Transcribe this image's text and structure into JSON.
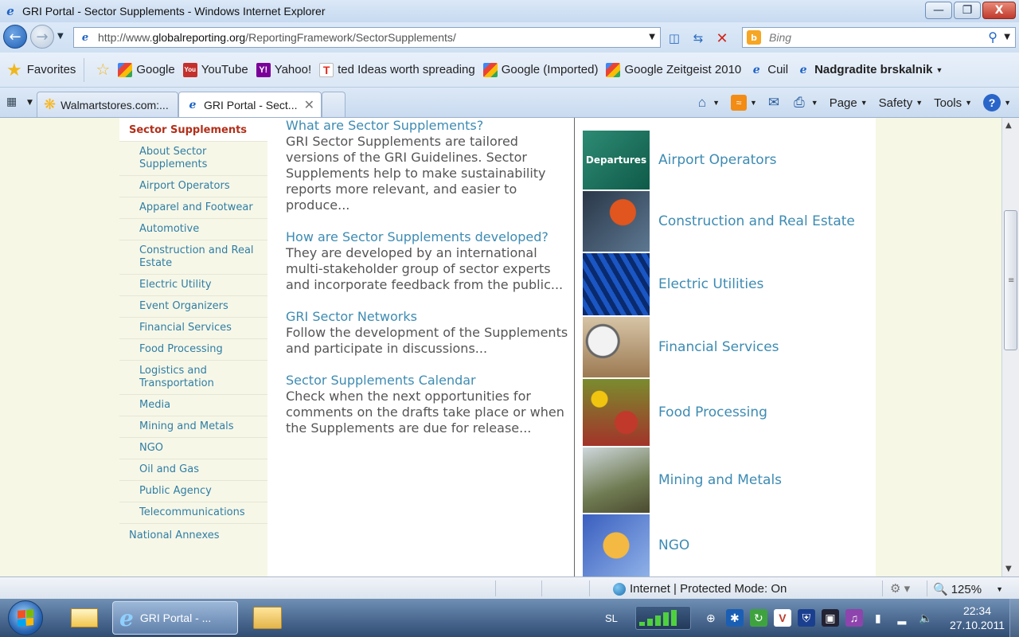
{
  "window": {
    "title": "GRI Portal - Sector Supplements - Windows Internet Explorer",
    "minimize": "—",
    "restore": "❐",
    "close": "X"
  },
  "address": {
    "url_prefix": "http://www.",
    "url_domain": "globalreporting.org",
    "url_path": "/ReportingFramework/SectorSupplements/",
    "search_placeholder": "Bing"
  },
  "favorites": {
    "label": "Favorites",
    "items": [
      {
        "label": "Google",
        "icon": "google-icon"
      },
      {
        "label": "YouTube",
        "icon": "youtube-icon"
      },
      {
        "label": "Yahoo!",
        "icon": "yahoo-icon"
      },
      {
        "label": "ted Ideas worth spreading",
        "icon": "ted-icon"
      },
      {
        "label": "Google (Imported)",
        "icon": "google-icon"
      },
      {
        "label": "Google Zeitgeist 2010",
        "icon": "google-icon"
      },
      {
        "label": "Cuil",
        "icon": "ie-page-icon"
      },
      {
        "label": "Nadgradite brskalnik",
        "icon": "ie-page-icon"
      }
    ]
  },
  "tabs": [
    {
      "label": "Walmartstores.com:..."
    },
    {
      "label": "GRI Portal - Sect...",
      "active": true
    }
  ],
  "commands": {
    "page": "Page",
    "safety": "Safety",
    "tools": "Tools"
  },
  "sidebar": {
    "heading": "Sector Supplements",
    "items": [
      "About Sector Supplements",
      "Airport Operators",
      "Apparel and Footwear",
      "Automotive",
      "Construction and Real Estate",
      "Electric Utility",
      "Event Organizers",
      "Financial Services",
      "Food Processing",
      "Logistics and Transportation",
      "Media",
      "Mining and Metals",
      "NGO",
      "Oil and Gas",
      "Public Agency",
      "Telecommunications"
    ],
    "footer": "National Annexes"
  },
  "content": {
    "sections": [
      {
        "title": "What are Sector Supplements?",
        "body": "GRI Sector Supplements are tailored versions of the GRI Guidelines. Sector Supplements help to make sustainability reports more relevant, and easier to produce..."
      },
      {
        "title": "How are Sector Supplements developed?",
        "body": "They are developed by an international multi-stakeholder group of sector experts and incorporate feedback from the public..."
      },
      {
        "title": "GRI Sector Networks",
        "body": "Follow the development of the Supplements and participate in discussions..."
      },
      {
        "title": "Sector Supplements Calendar",
        "body": "Check when the next opportunities for comments on the drafts take place or when the Supplements are due for release..."
      }
    ]
  },
  "sectors": [
    {
      "label": "Airport Operators",
      "image_text": "Departures"
    },
    {
      "label": "Construction and Real Estate"
    },
    {
      "label": "Electric Utilities"
    },
    {
      "label": "Financial Services"
    },
    {
      "label": "Food Processing"
    },
    {
      "label": "Mining and Metals"
    },
    {
      "label": "NGO"
    }
  ],
  "status": {
    "zone": "Internet | Protected Mode: On",
    "zoom": "125%"
  },
  "taskbar": {
    "ie_label": "GRI Portal - ...",
    "language": "SL",
    "time": "22:34",
    "date": "27.10.2011"
  }
}
